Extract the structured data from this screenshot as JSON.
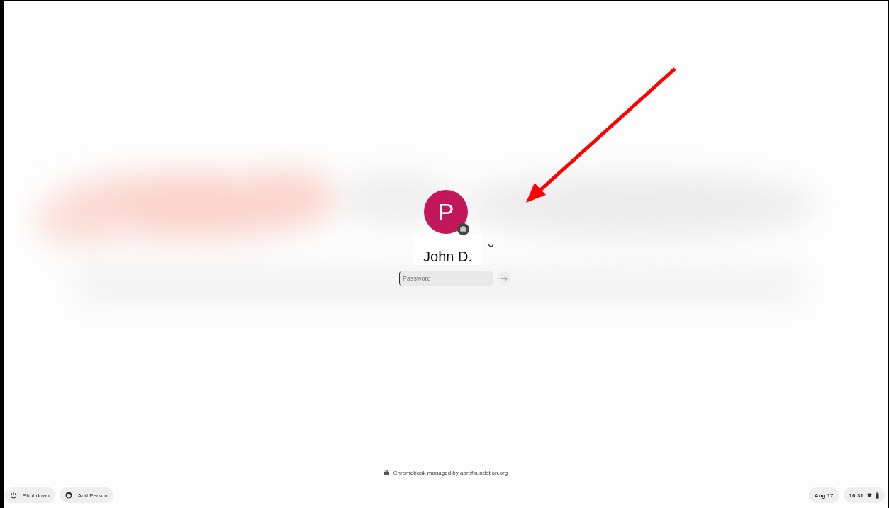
{
  "user": {
    "avatar_letter": "P",
    "name": "John D."
  },
  "password": {
    "placeholder": "Password"
  },
  "managed_note": "Chromebook managed by aarpfoundation.org",
  "shelf": {
    "left_buttons": [
      {
        "kind": "power",
        "label": "Shut down"
      },
      {
        "kind": "add-person",
        "label": "Add Person"
      }
    ],
    "date": "Aug 17",
    "time": "10:31"
  }
}
